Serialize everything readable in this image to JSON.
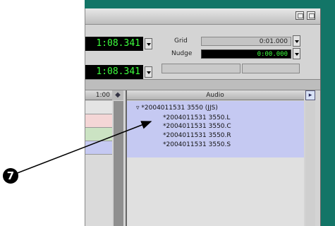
{
  "counters": {
    "main_top": "1:08.341",
    "main_bottom": "1:08.341"
  },
  "grid": {
    "label": "Grid",
    "value": "0:01.000"
  },
  "nudge": {
    "label": "Nudge",
    "value": "0:00.000"
  },
  "columns": {
    "ruler_label": "1:00",
    "audio_header": "Audio"
  },
  "region_tree": {
    "parent": "*2004011531 3550 (JJS)",
    "children": [
      "*2004011531 3550.L",
      "*2004011531 3550.C",
      "*2004011531 3550.R",
      "*2004011531 3550.S"
    ]
  },
  "callout": {
    "number": "7"
  },
  "colors": {
    "background_teal": "#137567",
    "region_list_bg": "#c5c9f2",
    "counter_text": "#3dff3d"
  }
}
